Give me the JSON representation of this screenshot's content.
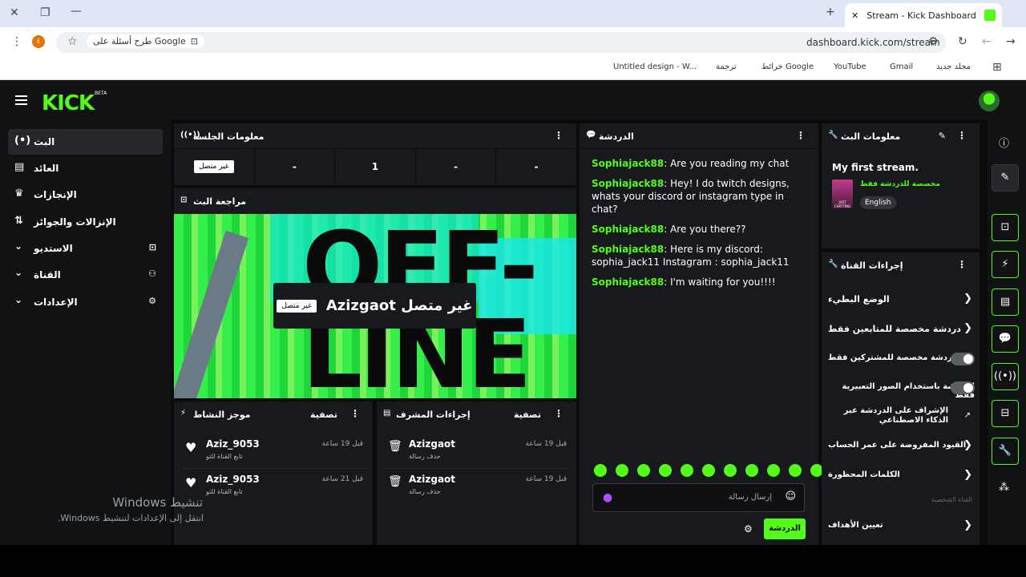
{
  "browser": {
    "tab_title": "Stream - Kick Dashboard",
    "url": "dashboard.kick.com/stream",
    "search_hint": "طرح أسئلة على Google",
    "ext_letter": "٤",
    "bookmarks": [
      "Untitled design - W...",
      "ترجمة",
      "خرائط Google",
      "YouTube",
      "Gmail",
      "مجلد جديد"
    ]
  },
  "app": {
    "logo": "KICK",
    "beta": "BETA",
    "accent": "#53fc18"
  },
  "sidebar": {
    "items": [
      {
        "label": "البث",
        "icon": "(•)"
      },
      {
        "label": "العائد",
        "icon": "▤"
      },
      {
        "label": "الإنجازات",
        "icon": "🏆"
      },
      {
        "label": "الإنزالات والجوائز",
        "icon": "⇅"
      },
      {
        "label": "الاستديو",
        "icon": "⌄"
      },
      {
        "label": "القناة",
        "icon": "⌄"
      },
      {
        "label": "الإعدادات",
        "icon": "⌄"
      }
    ]
  },
  "session": {
    "title": "معلومات الجلسة",
    "status_badge": "غير متصل",
    "stats": [
      "-",
      "1",
      "-",
      "-"
    ]
  },
  "preview": {
    "title": "مراجعة البث",
    "overlay_name": "غير متصل Azizgaot",
    "overlay_badge": "غير متصل",
    "bg_text": "OFF-LINE"
  },
  "activity": {
    "title": "موجز النشاط",
    "filter": "تصفية",
    "items": [
      {
        "name": "Aziz_9053",
        "sub": "تابع القناة للتو",
        "time": "قبل 19 ساعة"
      },
      {
        "name": "Aziz_9053",
        "sub": "تابع القناة للتو",
        "time": "قبل 21 ساعة"
      }
    ]
  },
  "modactions": {
    "title": "إجراءات المشرف",
    "filter": "تصفية",
    "items": [
      {
        "name": "Azizgaot",
        "sub": "حذف رسالة",
        "time": "قبل 19 ساعة"
      },
      {
        "name": "Azizgaot",
        "sub": "حذف رسالة",
        "time": "قبل 19 ساعة"
      }
    ]
  },
  "chat": {
    "title": "الدردشة",
    "messages": [
      {
        "user": "Sophiajack88",
        "text": ": Are you reading my chat"
      },
      {
        "user": "Sophiajack88",
        "text": ": Hey! I do twitch designs, whats your discord or instagram type in chat?"
      },
      {
        "user": "Sophiajack88",
        "text": ": Are you there??"
      },
      {
        "user": "Sophiajack88",
        "text": ": Here is my discord: sophia_jack11 Instagram : sophia_jack11"
      },
      {
        "user": "Sophiajack88",
        "text": ": I'm waiting for you!!!!"
      }
    ],
    "placeholder": "إرسال رسالة",
    "send_label": "الدردشة"
  },
  "streaminfo": {
    "title": "معلومات البث",
    "stream_title": "My first stream.",
    "category": "مخصصة للدردشة فقط",
    "language": "English",
    "thumb_text": "JUST CHATTING"
  },
  "channelactions": {
    "title": "إجراءات القناة",
    "items": [
      {
        "label": "الوضع البطيء",
        "kind": "chevron"
      },
      {
        "label": "دردشة مخصصة للمتابعين فقط",
        "kind": "chevron"
      },
      {
        "label": "الدردشة مخصصة للمشتركين فقط",
        "kind": "toggle"
      },
      {
        "label": "الدردشة باستخدام الصور التعبيرية فقط",
        "kind": "toggle"
      },
      {
        "label": "الإشراف على الدردشة عبر الذكاء الاصطناعي",
        "kind": "external"
      },
      {
        "label": "القيود المفروضة على عمر الحساب",
        "kind": "chevron"
      },
      {
        "label": "الكلمات المحظورة",
        "kind": "chevron"
      }
    ],
    "section_label": "القناة الشخصية",
    "goals_label": "تعيين الأهداف"
  },
  "watermark": {
    "line1": "تنشيط Windows",
    "line2": "انتقل إلى الإعدادات لتنشيط Windows."
  }
}
